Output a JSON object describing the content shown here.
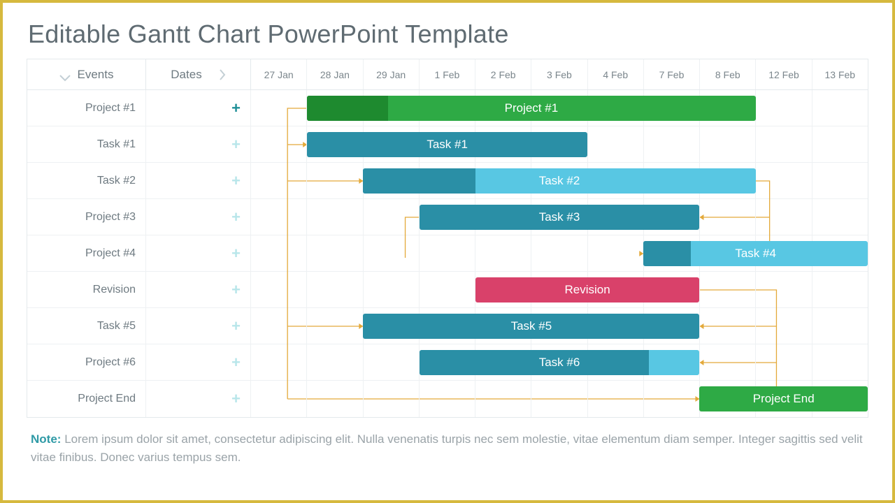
{
  "title": "Editable Gantt Chart PowerPoint Template",
  "header": {
    "events": "Events",
    "dates": "Dates"
  },
  "dates": [
    "27 Jan",
    "28 Jan",
    "29 Jan",
    "1 Feb",
    "2 Feb",
    "3 Feb",
    "4 Feb",
    "7 Feb",
    "8 Feb",
    "12 Feb",
    "13 Feb"
  ],
  "rows": [
    {
      "event": "Project #1",
      "active": true,
      "bar": {
        "label": "Project #1",
        "start": 1,
        "span": 8,
        "fill": "#2eaa45",
        "prog_span": 1.45,
        "prog_fill": "#1e8a2f"
      }
    },
    {
      "event": "Task #1",
      "active": false,
      "bar": {
        "label": "Task #1",
        "start": 1,
        "span": 5,
        "fill": "#2a8fa6"
      }
    },
    {
      "event": "Task #2",
      "active": false,
      "bar": {
        "label": "Task #2",
        "start": 2,
        "span": 7,
        "fill": "#58c7e3",
        "prog_span": 2.0,
        "prog_fill": "#2a8fa6"
      }
    },
    {
      "event": "Project #3",
      "active": false,
      "bar": {
        "label": "Task #3",
        "start": 3,
        "span": 5,
        "fill": "#2a8fa6"
      }
    },
    {
      "event": "Project #4",
      "active": false,
      "bar": {
        "label": "Task #4",
        "start": 7,
        "span": 4,
        "fill": "#58c7e3",
        "prog_span": 0.85,
        "prog_fill": "#2a8fa6"
      }
    },
    {
      "event": "Revision",
      "active": false,
      "bar": {
        "label": "Revision",
        "start": 4,
        "span": 4,
        "fill": "#d9416a"
      }
    },
    {
      "event": "Task #5",
      "active": false,
      "bar": {
        "label": "Task #5",
        "start": 2,
        "span": 6,
        "fill": "#2a8fa6"
      }
    },
    {
      "event": "Project #6",
      "active": false,
      "bar": {
        "label": "Task #6",
        "start": 3,
        "span": 5,
        "fill": "#2a8fa6",
        "prog_span": 4.1,
        "prog_fill": "#2a8fa6",
        "tail_fill": "#58c7e3"
      }
    },
    {
      "event": "Project End",
      "active": false,
      "bar": {
        "label": "Project End",
        "start": 8,
        "span": 3,
        "fill": "#2eaa45"
      }
    }
  ],
  "note_label": "Note:",
  "note_text": "Lorem ipsum dolor sit amet, consectetur adipiscing elit. Nulla venenatis turpis nec sem molestie, vitae elementum diam semper. Integer sagittis sed velit vitae finibus. Donec varius tempus sem.",
  "colors": {
    "border": "#d6b93e",
    "connector": "#e3a93a"
  },
  "chart_data": {
    "type": "gantt",
    "title": "Editable Gantt Chart PowerPoint Template",
    "header": {
      "events": "Events",
      "dates": "Dates"
    },
    "timescale": [
      "27 Jan",
      "28 Jan",
      "29 Jan",
      "1 Feb",
      "2 Feb",
      "3 Feb",
      "4 Feb",
      "7 Feb",
      "8 Feb",
      "12 Feb",
      "13 Feb"
    ],
    "tasks": [
      {
        "row_label": "Project #1",
        "bar_label": "Project #1",
        "start": "28 Jan",
        "end": "8 Feb",
        "color": "#2eaa45",
        "progress_pct": 18
      },
      {
        "row_label": "Task #1",
        "bar_label": "Task #1",
        "start": "28 Jan",
        "end": "3 Feb",
        "color": "#2a8fa6"
      },
      {
        "row_label": "Task #2",
        "bar_label": "Task #2",
        "start": "29 Jan",
        "end": "8 Feb",
        "color": "#58c7e3",
        "progress_pct": 28
      },
      {
        "row_label": "Project #3",
        "bar_label": "Task #3",
        "start": "1 Feb",
        "end": "7 Feb",
        "color": "#2a8fa6"
      },
      {
        "row_label": "Project #4",
        "bar_label": "Task #4",
        "start": "7 Feb",
        "end": "13 Feb",
        "color": "#58c7e3",
        "progress_pct": 21
      },
      {
        "row_label": "Revision",
        "bar_label": "Revision",
        "start": "2 Feb",
        "end": "7 Feb",
        "color": "#d9416a"
      },
      {
        "row_label": "Task #5",
        "bar_label": "Task #5",
        "start": "29 Jan",
        "end": "7 Feb",
        "color": "#2a8fa6"
      },
      {
        "row_label": "Project #6",
        "bar_label": "Task #6",
        "start": "1 Feb",
        "end": "7 Feb",
        "color": "#2a8fa6",
        "progress_pct": 82
      },
      {
        "row_label": "Project End",
        "bar_label": "Project End",
        "start": "8 Feb",
        "end": "13 Feb",
        "color": "#2eaa45"
      }
    ],
    "dependencies": [
      {
        "from": "Project #1",
        "to": "Task #1"
      },
      {
        "from": "Project #1",
        "to": "Task #2"
      },
      {
        "from": "Project #1",
        "to": "Task #5"
      },
      {
        "from": "Project #1",
        "to": "Project End"
      },
      {
        "from": "Task #2",
        "to": "Task #3"
      },
      {
        "from": "Task #2",
        "to": "Task #4"
      },
      {
        "from": "Revision",
        "to": "Task #6"
      },
      {
        "from": "Revision",
        "to": "Project End"
      }
    ],
    "note": {
      "label": "Note:",
      "text": "Lorem ipsum dolor sit amet, consectetur adipiscing elit. Nulla venenatis turpis nec sem molestie, vitae elementum diam semper. Integer sagittis sed velit vitae finibus. Donec varius tempus sem."
    }
  }
}
